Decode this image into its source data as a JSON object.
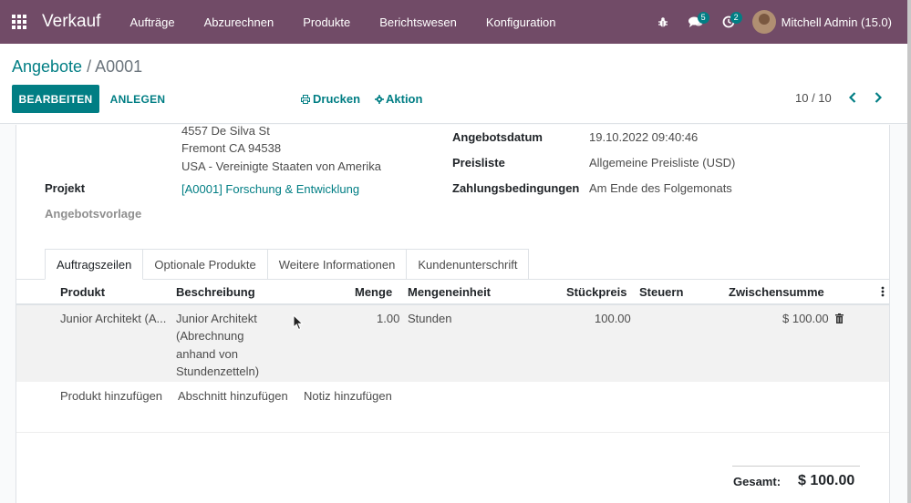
{
  "navbar": {
    "app_name": "Verkauf",
    "menu": [
      "Aufträge",
      "Abzurechnen",
      "Produkte",
      "Berichtswesen",
      "Konfiguration"
    ],
    "messages_count": "5",
    "activities_count": "2",
    "user_name": "Mitchell Admin (15.0)"
  },
  "breadcrumb": {
    "parent": "Angebote",
    "separator": "/",
    "current": "A0001"
  },
  "buttons": {
    "edit": "BEARBEITEN",
    "create": "ANLEGEN",
    "print": "Drucken",
    "action": "Aktion"
  },
  "pager": {
    "value": "10 / 10"
  },
  "form": {
    "address_line1": "4557 De Silva St",
    "address_line2": "Fremont CA 94538",
    "address_line3": "USA - Vereinigte Staaten von Amerika",
    "project_label": "Projekt",
    "project_value": "[A0001] Forschung & Entwicklung",
    "template_label": "Angebotsvorlage",
    "date_label": "Angebotsdatum",
    "date_value": "19.10.2022 09:40:46",
    "pricelist_label": "Preisliste",
    "pricelist_value": "Allgemeine Preisliste (USD)",
    "payment_label": "Zahlungsbedingungen",
    "payment_value": "Am Ende des Folgemonats"
  },
  "tabs": [
    "Auftragszeilen",
    "Optionale Produkte",
    "Weitere Informationen",
    "Kundenunterschrift"
  ],
  "table": {
    "headers": {
      "product": "Produkt",
      "description": "Beschreibung",
      "quantity": "Menge",
      "uom": "Mengeneinheit",
      "price": "Stückpreis",
      "taxes": "Steuern",
      "subtotal": "Zwischensumme"
    },
    "rows": [
      {
        "product": "Junior Architekt (A...",
        "description_lines": [
          "Junior Architekt",
          "(Abrechnung",
          "anhand von",
          "Stundenzetteln)"
        ],
        "quantity": "1.00",
        "uom": "Stunden",
        "price": "100.00",
        "taxes": "",
        "subtotal": "$ 100.00"
      }
    ],
    "add_product": "Produkt hinzufügen",
    "add_section": "Abschnitt hinzufügen",
    "add_note": "Notiz hinzufügen"
  },
  "totals": {
    "label": "Gesamt:",
    "value": "$ 100.00"
  },
  "colors": {
    "navbar": "#714b67",
    "primary": "#017e84"
  }
}
